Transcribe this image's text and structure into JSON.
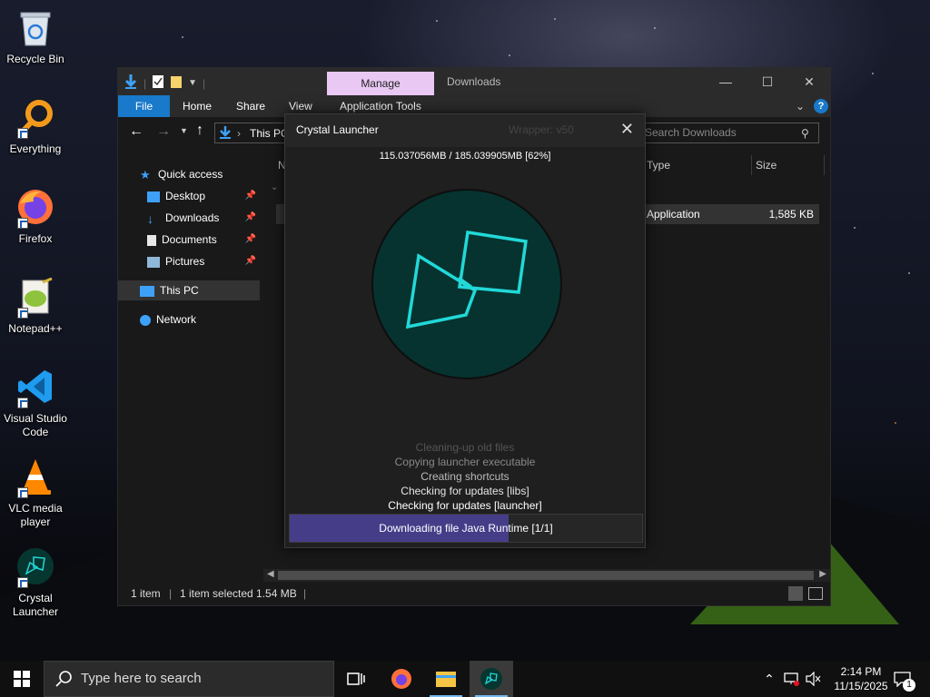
{
  "desktop": {
    "icons": [
      {
        "label": "Recycle Bin",
        "icon": "recycle-bin-icon"
      },
      {
        "label": "Everything",
        "icon": "everything-search-icon"
      },
      {
        "label": "Firefox",
        "icon": "firefox-icon"
      },
      {
        "label": "Notepad++",
        "icon": "notepad-plus-plus-icon"
      },
      {
        "label": "Visual Studio Code",
        "icon": "vscode-icon"
      },
      {
        "label": "VLC media player",
        "icon": "vlc-icon"
      },
      {
        "label": "Crystal Launcher",
        "icon": "crystal-launcher-icon"
      }
    ]
  },
  "explorer": {
    "manage_tab": "Manage",
    "title": "Downloads",
    "ribbon": {
      "file": "File",
      "home": "Home",
      "share": "Share",
      "view": "View",
      "app_tools": "Application Tools"
    },
    "address": "This PC",
    "search_placeholder": "Search Downloads",
    "nav": {
      "quick_access": "Quick access",
      "desktop": "Desktop",
      "downloads": "Downloads",
      "documents": "Documents",
      "pictures": "Pictures",
      "this_pc": "This PC",
      "network": "Network"
    },
    "columns": {
      "name": "N",
      "type": "Type",
      "size": "Size"
    },
    "file": {
      "type": "Application",
      "size": "1,585 KB"
    },
    "status": {
      "items": "1 item",
      "selected": "1 item selected  1.54 MB"
    }
  },
  "launcher": {
    "title": "Crystal Launcher",
    "wrapper": "Wrapper: v50",
    "progress_text": "115.037056MB / 185.039905MB [62%]",
    "progress": 0.62,
    "log": [
      "Cleaning-up old files",
      "Copying launcher executable",
      "Creating shortcuts",
      "Checking for updates [libs]",
      "Checking for updates [launcher]"
    ],
    "download_text": "Downloading file Java Runtime [1/1]"
  },
  "taskbar": {
    "search_placeholder": "Type here to search",
    "time": "2:14 PM",
    "date": "11/15/2025",
    "notification_count": "1"
  },
  "colors": {
    "accent": "#1979ca",
    "manage_tab": "#e9c8f3",
    "progress_fill": "#463d89",
    "logo_bg": "#06332f",
    "logo_stroke": "#22d8d8"
  }
}
